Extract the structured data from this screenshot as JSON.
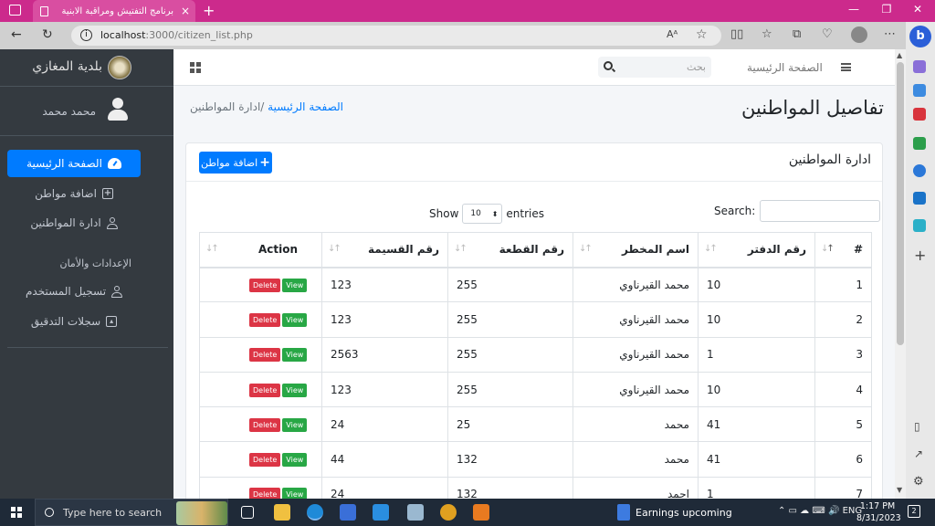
{
  "browser": {
    "tab_title": "برنامج التفتيش ومراقبة الابنية",
    "tab_close": "×",
    "new_tab": "+",
    "url_host": "localhost",
    "url_path": ":3000/citizen_list.php",
    "info": "i",
    "bing": "b"
  },
  "sidebar": {
    "brand": "بلدية المغازي",
    "user_name": "محمد محمد",
    "items": [
      {
        "label": "الصفحة الرئيسية",
        "icon": "gauge-icon",
        "active": true
      },
      {
        "label": "اضافة مواطن",
        "icon": "plus-square-icon"
      },
      {
        "label": "ادارة المواطنين",
        "icon": "user-icon"
      }
    ],
    "header": "الإعدادات والأمان",
    "settings_items": [
      {
        "label": "تسجيل المستخدم",
        "icon": "user-icon"
      },
      {
        "label": "سجلات التدقيق",
        "icon": "image-icon"
      }
    ]
  },
  "topnav": {
    "home_link": "الصفحة الرئيسية",
    "search_placeholder": "بحث"
  },
  "page": {
    "title": "تفاصيل المواطنين",
    "breadcrumb_home": "الصفحة الرئيسية",
    "breadcrumb_current": "/ادارة المواطنين"
  },
  "card": {
    "title": "ادارة المواطنين",
    "add_button": "اضافة مواطن"
  },
  "datatable": {
    "show_label": "Show",
    "entries_value": "10",
    "entries_label": "entries",
    "search_label": "Search:",
    "columns": [
      "#",
      "رقم الدفتر",
      "اسم المخطر",
      "رقم القطعة",
      "رقم القسيمة",
      "Action"
    ],
    "view_label": "View",
    "delete_label": "Delete",
    "rows": [
      [
        "1",
        "10",
        "محمد القيرناوي",
        "255",
        "123"
      ],
      [
        "2",
        "10",
        "محمد القيرناوي",
        "255",
        "123"
      ],
      [
        "3",
        "1",
        "محمد القيرناوي",
        "255",
        "2563"
      ],
      [
        "4",
        "10",
        "محمد القيرناوي",
        "255",
        "123"
      ],
      [
        "5",
        "41",
        "محمد",
        "25",
        "24"
      ],
      [
        "6",
        "41",
        "محمد",
        "132",
        "44"
      ],
      [
        "7",
        "1",
        "احمد",
        "132",
        "24"
      ]
    ]
  },
  "taskbar": {
    "search_placeholder": "Type here to search",
    "weather": "Earnings upcoming",
    "lang": "ENG",
    "time": "1:17 PM",
    "date": "8/31/2023",
    "notifications": "2"
  },
  "colors": {
    "titlebar": "#cc2a8c",
    "sidebar": "#343a40",
    "primary": "#007bff",
    "success": "#28a745",
    "danger": "#dc3545"
  }
}
